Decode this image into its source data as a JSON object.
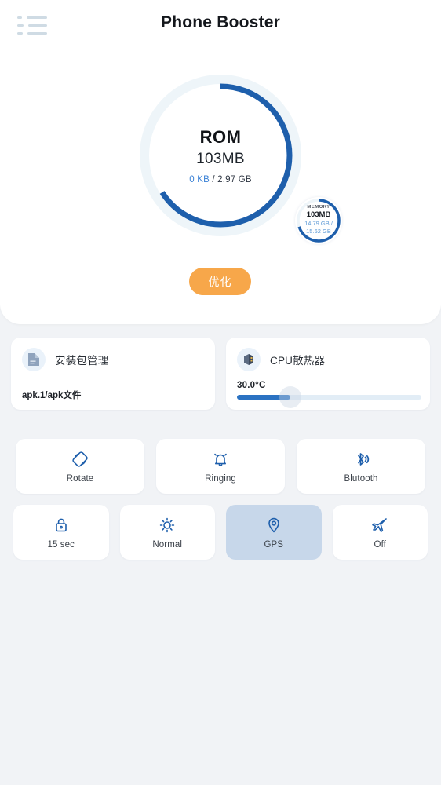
{
  "header": {
    "title": "Phone Booster",
    "menu_icon": "hamburger-menu-icon"
  },
  "gauge": {
    "label": "ROM",
    "value": "103MB",
    "used": "0 KB",
    "separator": " / ",
    "total": "2.97 GB",
    "arc_percent": 66,
    "arc_color": "#1e5fac",
    "track_color": "#eef5f9"
  },
  "mini_gauge": {
    "label": "MEMORY",
    "value": "103MB",
    "used": "14.79 GB /",
    "total": "15.62 GB",
    "arc_percent": 70,
    "arc_color": "#1e5fac"
  },
  "optimize": {
    "label": "优化",
    "color": "#f7a74a"
  },
  "cards": [
    {
      "icon": "apk-file-icon",
      "title": "安装包管理",
      "footer": "apk.1/apk文件"
    },
    {
      "icon": "cpu-chip-icon",
      "title": "CPU散热器",
      "temperature": "30.0°C",
      "slider_percent": 29
    }
  ],
  "tiles_row_1": [
    {
      "icon": "screen-rotate-icon",
      "label": "Rotate",
      "active": false
    },
    {
      "icon": "bell-ringing-icon",
      "label": "Ringing",
      "active": false
    },
    {
      "icon": "bluetooth-icon",
      "label": "Blutooth",
      "active": false
    }
  ],
  "tiles_row_2": [
    {
      "icon": "lock-timeout-icon",
      "label": "15 sec",
      "active": false
    },
    {
      "icon": "brightness-sun-icon",
      "label": "Normal",
      "active": false
    },
    {
      "icon": "location-pin-icon",
      "label": "GPS",
      "active": true
    },
    {
      "icon": "airplane-mode-icon",
      "label": "Off",
      "active": false
    }
  ],
  "colors": {
    "page_background": "#f1f3f6",
    "panel": "#ffffff",
    "accent_blue": "#1e5fac",
    "accent_orange": "#f7a74a",
    "tile_active": "#c7d7ea"
  }
}
